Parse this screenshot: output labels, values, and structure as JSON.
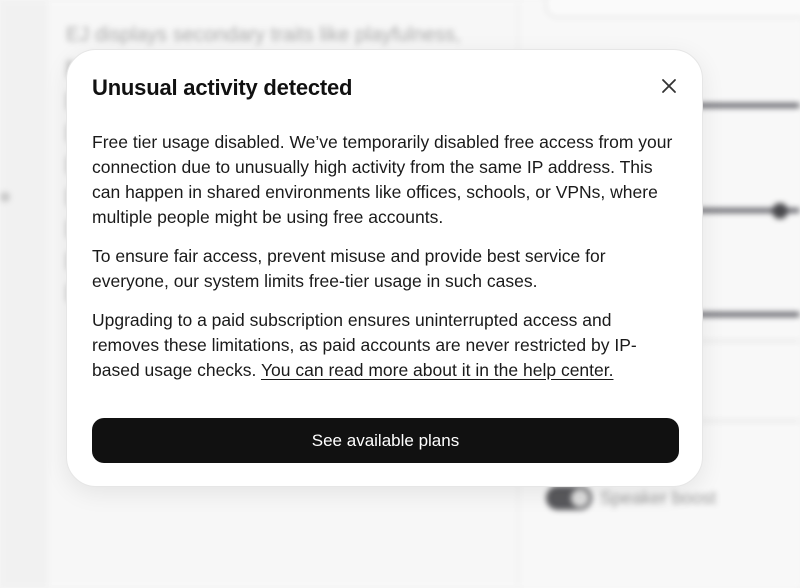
{
  "background": {
    "editor_text": "EJ displays secondary traits like playfulness,",
    "toggle_label": "Speaker boost"
  },
  "modal": {
    "title": "Unusual activity detected",
    "close_icon": "close-icon",
    "paragraphs": [
      "Free tier usage disabled. We’ve temporarily disabled free access from your connection due to unusually high activity from the same IP address. This can happen in shared environments like offices, schools, or VPNs, where multiple people might be using free accounts.",
      "To ensure fair access, prevent misuse and provide best service for everyone, our system limits free-tier usage in such cases.",
      "Upgrading to a paid subscription ensures uninterrupted access and removes these limitations, as paid accounts are never restricted by IP-based usage checks."
    ],
    "help_link": "You can read more about it in the help center.",
    "primary_button": "See available plans"
  },
  "colors": {
    "button_bg": "#111111",
    "button_text": "#ffffff",
    "modal_bg": "#ffffff",
    "text": "#1a1a1a"
  }
}
